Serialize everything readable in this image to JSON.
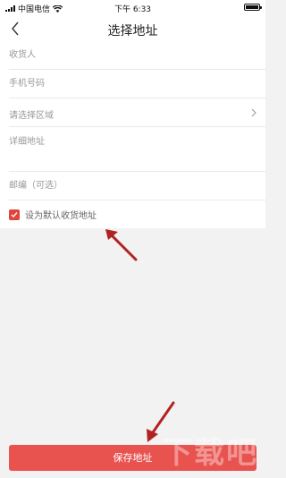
{
  "status_bar": {
    "carrier": "中国电信",
    "time": "下午 6:33"
  },
  "nav": {
    "title": "选择地址"
  },
  "form": {
    "recipient_placeholder": "收货人",
    "phone_placeholder": "手机号码",
    "region_label": "请选择区域",
    "address_placeholder": "详细地址",
    "postcode_placeholder": "邮编（可选）",
    "default_checkbox_label": "设为默认收货地址"
  },
  "footer": {
    "save_label": "保存地址",
    "watermark": "下载吧"
  },
  "colors": {
    "accent": "#e8534f",
    "checkbox": "#e0443c",
    "arrow": "#b22222"
  }
}
